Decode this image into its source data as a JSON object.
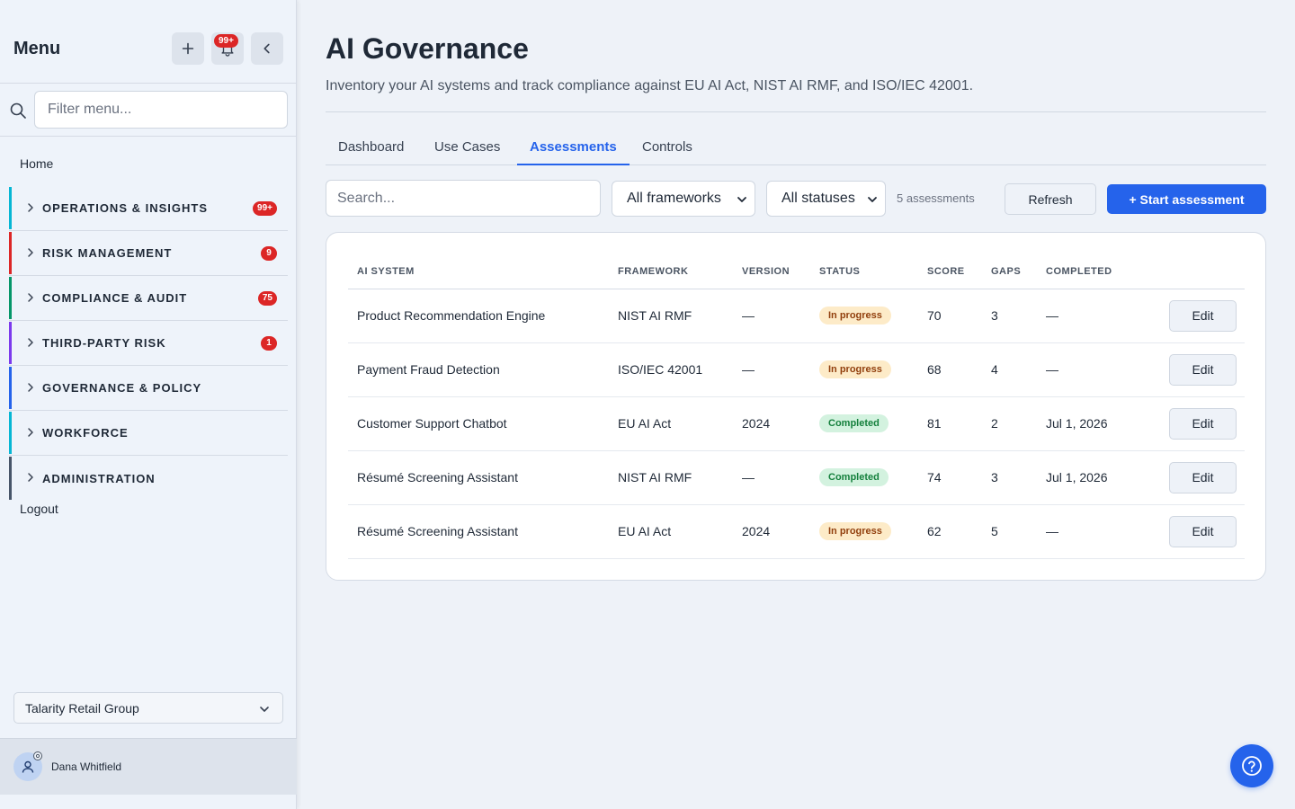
{
  "sidebar": {
    "title": "Menu",
    "notification_count": "99+",
    "filter_placeholder": "Filter menu...",
    "home_label": "Home",
    "groups": [
      {
        "label": "OPERATIONS & INSIGHTS",
        "count": "99+",
        "color": "#06b6d4"
      },
      {
        "label": "RISK MANAGEMENT",
        "count": "9",
        "color": "#dc2626"
      },
      {
        "label": "COMPLIANCE & AUDIT",
        "count": "75",
        "color": "#059669"
      },
      {
        "label": "THIRD-PARTY RISK",
        "count": "1",
        "color": "#7c3aed"
      },
      {
        "label": "GOVERNANCE & POLICY",
        "count": "",
        "color": "#2563eb"
      },
      {
        "label": "WORKFORCE",
        "count": "",
        "color": "#06b6d4"
      },
      {
        "label": "ADMINISTRATION",
        "count": "",
        "color": "#475569"
      }
    ],
    "logout_label": "Logout",
    "org_select": "Talarity Retail Group",
    "user_name": "Dana Whitfield"
  },
  "main": {
    "title": "AI Governance",
    "subtitle": "Inventory your AI systems and track compliance against EU AI Act, NIST AI RMF, and ISO/IEC 42001.",
    "tabs": [
      {
        "label": "Dashboard",
        "active": false
      },
      {
        "label": "Use Cases",
        "active": false
      },
      {
        "label": "Assessments",
        "active": true
      },
      {
        "label": "Controls",
        "active": false
      }
    ],
    "toolbar": {
      "search_placeholder": "Search...",
      "framework_filter": "All frameworks",
      "status_filter": "All statuses",
      "count_text": "5 assessments",
      "refresh_label": "Refresh",
      "start_label": "+ Start assessment"
    },
    "table": {
      "headers": [
        "AI SYSTEM",
        "FRAMEWORK",
        "VERSION",
        "STATUS",
        "SCORE",
        "GAPS",
        "COMPLETED"
      ],
      "edit_label": "Edit",
      "rows": [
        {
          "system": "Product Recommendation Engine",
          "framework": "NIST AI RMF",
          "version": "—",
          "status": "In progress",
          "status_kind": "progress",
          "score": "70",
          "gaps": "3",
          "completed": "—"
        },
        {
          "system": "Payment Fraud Detection",
          "framework": "ISO/IEC 42001",
          "version": "—",
          "status": "In progress",
          "status_kind": "progress",
          "score": "68",
          "gaps": "4",
          "completed": "—"
        },
        {
          "system": "Customer Support Chatbot",
          "framework": "EU AI Act",
          "version": "2024",
          "status": "Completed",
          "status_kind": "done",
          "score": "81",
          "gaps": "2",
          "completed": "Jul 1, 2026"
        },
        {
          "system": "Résumé Screening Assistant",
          "framework": "NIST AI RMF",
          "version": "—",
          "status": "Completed",
          "status_kind": "done",
          "score": "74",
          "gaps": "3",
          "completed": "Jul 1, 2026"
        },
        {
          "system": "Résumé Screening Assistant",
          "framework": "EU AI Act",
          "version": "2024",
          "status": "In progress",
          "status_kind": "progress",
          "score": "62",
          "gaps": "5",
          "completed": "—"
        }
      ]
    }
  },
  "icons": {
    "add": "plus-icon",
    "notifications": "bell-icon",
    "collapse": "chevron-left-icon",
    "filter": "search-icon",
    "help": "help-icon"
  },
  "colors": {
    "accent": "#2563eb",
    "badge": "#dc2626"
  }
}
